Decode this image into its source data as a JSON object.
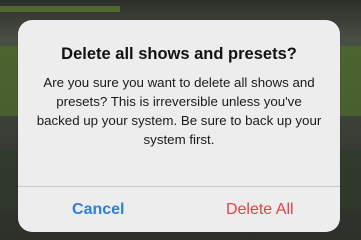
{
  "alert": {
    "title": "Delete all shows and presets?",
    "message": "Are you sure you want to delete all shows and presets? This is irreversible unless you've backed up your system. Be sure to back up your system first.",
    "cancel_label": "Cancel",
    "delete_label": "Delete All"
  },
  "colors": {
    "cancel": "#2f7fd6",
    "destructive": "#ea3e46",
    "alert_background": "#ededed"
  }
}
